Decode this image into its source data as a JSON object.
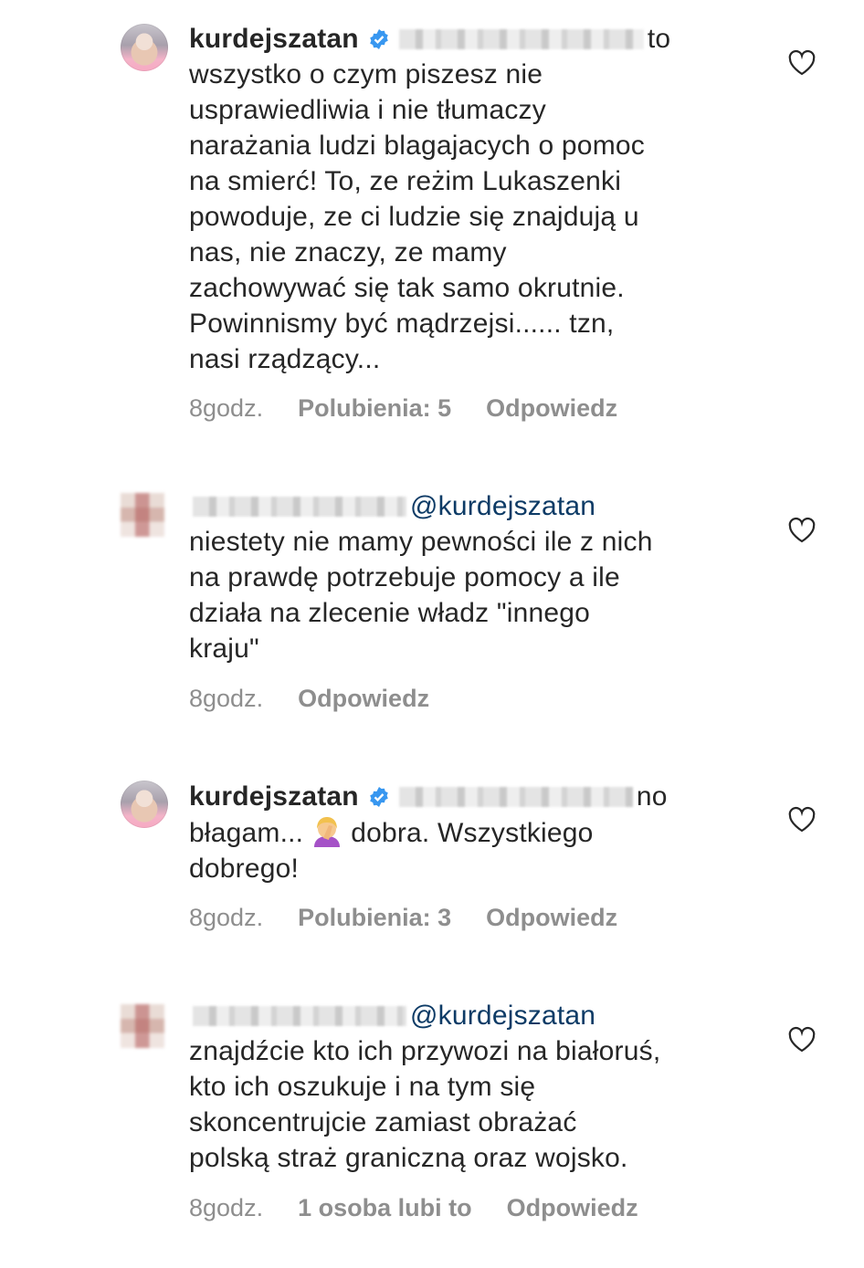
{
  "comments": [
    {
      "username": "kurdejszatan",
      "verified": true,
      "text_after_mention": "to",
      "lines": [
        "wszystko o czym piszesz nie",
        "usprawiedliwia i nie tłumaczy",
        "narażania ludzi blagajacych o pomoc",
        "na smierć! To, ze reżim Lukaszenki",
        "powoduje, ze ci ludzie się znajdują u",
        "nas, nie znaczy, ze mamy",
        "zachowywać się tak samo okrutnie.",
        "Powinnismy być mądrzejsi...... tzn,",
        "nasi rządzący..."
      ],
      "time": "8godz.",
      "likes": "Polubienia: 5",
      "reply": "Odpowiedz"
    },
    {
      "mention": "@kurdejszatan",
      "lines": [
        "niestety nie mamy pewności ile z nich",
        "na prawdę potrzebuje pomocy a ile",
        "działa na zlecenie władz \"innego",
        "kraju\""
      ],
      "time": "8godz.",
      "reply": "Odpowiedz"
    },
    {
      "username": "kurdejszatan",
      "verified": true,
      "text_after_mention": "no",
      "line2_before_emoji": "błagam...",
      "emoji": "woman-facepalming-emoji",
      "line2_after_emoji": "dobra. Wszystkiego",
      "line3": "dobrego!",
      "time": "8godz.",
      "likes": "Polubienia: 3",
      "reply": "Odpowiedz"
    },
    {
      "mention": "@kurdejszatan",
      "lines": [
        "znajdźcie kto ich przywozi na białoruś,",
        "kto ich oszukuje i na tym się",
        "skoncentrujcie zamiast obrażać",
        "polską straż graniczną oraz wojsko."
      ],
      "time": "8godz.",
      "likes": "1 osoba lubi to",
      "reply": "Odpowiedz"
    }
  ],
  "colors": {
    "text": "#262626",
    "meta": "#8e8e8e",
    "mention": "#0d3b66",
    "verified": "#3897f0"
  }
}
